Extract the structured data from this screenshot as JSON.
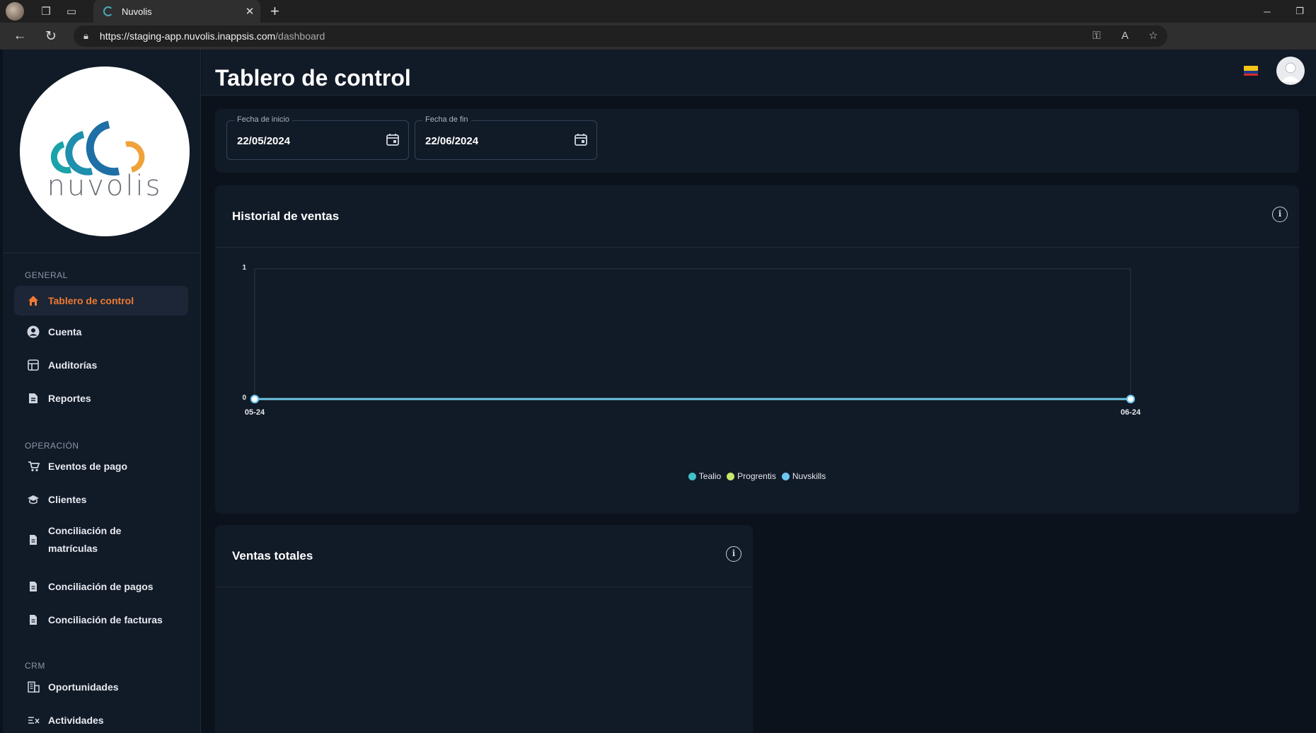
{
  "browser": {
    "tab_title": "Nuvolis",
    "url_host": "https://staging-app.nuvolis.inappsis.com",
    "url_path": "/dashboard"
  },
  "sidebar": {
    "logo_text": "nuvolis",
    "sections": {
      "general": "GENERAL",
      "operacion": "OPERACIÓN",
      "crm": "CRM"
    },
    "items": [
      {
        "label": "Tablero de control",
        "icon": "home-icon",
        "active": true
      },
      {
        "label": "Cuenta",
        "icon": "account-icon"
      },
      {
        "label": "Auditorías",
        "icon": "audit-icon"
      },
      {
        "label": "Reportes",
        "icon": "report-icon"
      },
      {
        "label": "Eventos de pago",
        "icon": "cart-icon"
      },
      {
        "label": "Clientes",
        "icon": "graduation-cap-icon"
      },
      {
        "label": "Conciliación de matrículas",
        "icon": "document-icon"
      },
      {
        "label": "Conciliación de pagos",
        "icon": "document-icon"
      },
      {
        "label": "Conciliación de facturas",
        "icon": "document-icon"
      },
      {
        "label": "Oportunidades",
        "icon": "building-icon"
      },
      {
        "label": "Actividades",
        "icon": "checklist-icon"
      }
    ]
  },
  "header": {
    "flag": "colombia-flag",
    "avatar": "user-avatar"
  },
  "page": {
    "title": "Tablero de control"
  },
  "filters": {
    "start": {
      "label": "Fecha de inicio",
      "value": "22/05/2024"
    },
    "end": {
      "label": "Fecha de fin",
      "value": "22/06/2024"
    }
  },
  "cards": {
    "sales_history": "Historial de ventas",
    "total_sales": "Ventas totales"
  },
  "colors": {
    "accent": "#f07a33",
    "tealio": "#3fc1c9",
    "progrentis": "#c6e86a",
    "nuvskills": "#6cc6f2"
  },
  "chart_data": {
    "type": "line",
    "title": "Historial de ventas",
    "x": [
      "05-24",
      "06-24"
    ],
    "ylim": [
      0,
      1
    ],
    "yticks": [
      "0",
      "1"
    ],
    "series": [
      {
        "name": "Tealio",
        "values": [
          0,
          0
        ],
        "color": "#3fc1c9"
      },
      {
        "name": "Progrentis",
        "values": [
          0,
          0
        ],
        "color": "#c6e86a"
      },
      {
        "name": "Nuvskills",
        "values": [
          0,
          0
        ],
        "color": "#6cc6f2"
      }
    ],
    "legend_position": "bottom-center",
    "grid": false
  }
}
